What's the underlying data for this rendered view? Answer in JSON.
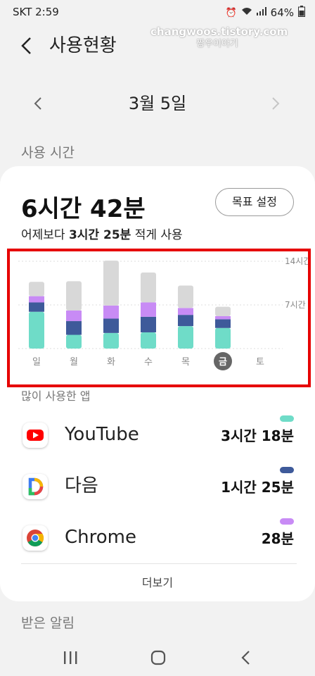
{
  "status_bar": {
    "carrier": "SKT",
    "time": "2:59",
    "battery": "64%"
  },
  "watermark": {
    "line1": "changwoos.tistory.com",
    "line2": "짱우이야기"
  },
  "header": {
    "title": "사용현황"
  },
  "date_nav": {
    "label": "3월 5일"
  },
  "usage": {
    "section_title": "사용 시간",
    "total": "6시간 42분",
    "goal_button": "목표 설정",
    "compare_prefix": "어제보다 ",
    "compare_amount": "3시간 25분",
    "compare_suffix": " 적게 사용"
  },
  "chart_data": {
    "type": "bar",
    "stacked": true,
    "categories": [
      "일",
      "월",
      "화",
      "수",
      "목",
      "금",
      "토"
    ],
    "selected_category": "금",
    "y_tick_labels": [
      "14시간",
      "7시간"
    ],
    "y_ticks": [
      14,
      7
    ],
    "ylim": [
      0,
      14
    ],
    "unit": "hours",
    "series": [
      {
        "color": "#6fdcc8",
        "values": [
          5.9,
          2.2,
          2.5,
          2.6,
          3.6,
          3.3,
          0
        ]
      },
      {
        "color": "#3e5a9a",
        "values": [
          1.5,
          2.2,
          2.3,
          2.5,
          1.8,
          1.4,
          0
        ]
      },
      {
        "color": "#c88bf5",
        "values": [
          1.0,
          1.7,
          2.1,
          2.3,
          1.1,
          0.5,
          0
        ]
      },
      {
        "color": "#d8d8d8",
        "values": [
          2.3,
          4.7,
          7.2,
          4.8,
          3.6,
          1.5,
          0
        ]
      }
    ]
  },
  "apps": {
    "section_title": "많이 사용한 앱",
    "items": [
      {
        "name": "YouTube",
        "time": "3시간 18분",
        "dot_color": "#6fdcc8",
        "icon": "youtube-icon"
      },
      {
        "name": "다음",
        "time": "1시간 25분",
        "dot_color": "#3e5a9a",
        "icon": "daum-icon"
      },
      {
        "name": "Chrome",
        "time": "28분",
        "dot_color": "#c88bf5",
        "icon": "chrome-icon"
      }
    ],
    "more_label": "더보기"
  },
  "notifications": {
    "section_title": "받은 알림"
  }
}
